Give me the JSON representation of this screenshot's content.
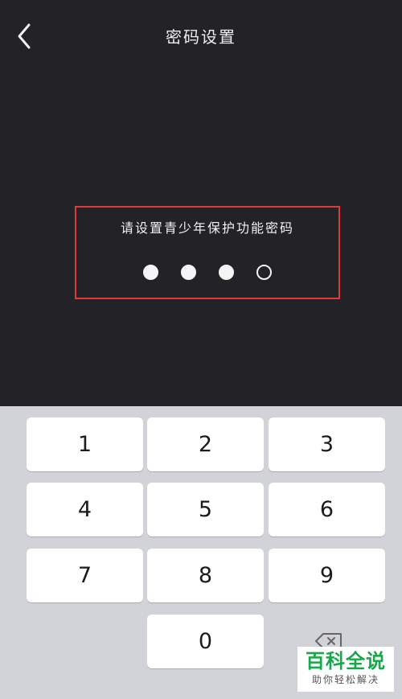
{
  "header": {
    "title": "密码设置",
    "back_icon": "chevron-left-icon"
  },
  "prompt": {
    "text": "请设置青少年保护功能密码",
    "entered": 3,
    "total": 4
  },
  "keyboard": {
    "keys": [
      "1",
      "2",
      "3",
      "4",
      "5",
      "6",
      "7",
      "8",
      "9",
      "0"
    ],
    "delete_icon": "backspace-icon"
  },
  "watermark": {
    "title": "百科全说",
    "subtitle": "助你轻松解决"
  },
  "colors": {
    "background": "#222227",
    "highlight_border": "#e0393c",
    "keyboard_bg": "#d2d3d8",
    "key_bg": "#ffffff",
    "watermark_green": "#1aa64a"
  }
}
